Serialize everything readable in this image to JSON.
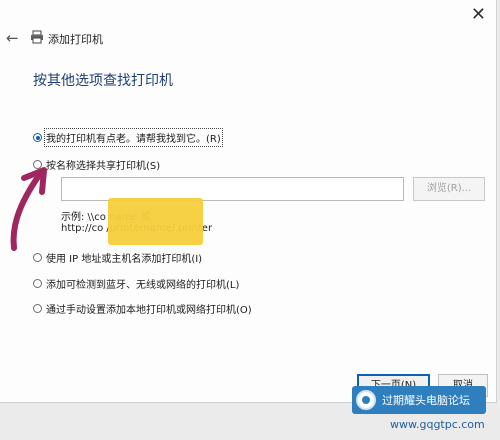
{
  "window": {
    "close_glyph": "✕",
    "back_glyph": "←",
    "title": "添加打印机"
  },
  "heading": "按其他选项查找打印机",
  "options": [
    {
      "label": "我的打印机有点老。请帮我找到它。(R)",
      "checked": true
    },
    {
      "label": "按名称选择共享打印机(S)",
      "checked": false
    },
    {
      "label": "使用 IP 地址或主机名添加打印机(I)",
      "checked": false
    },
    {
      "label": "添加可检测到蓝牙、无线或网络的打印机(L)",
      "checked": false
    },
    {
      "label": "通过手动设置添加本地打印机或网络打印机(O)",
      "checked": false
    }
  ],
  "share_input": {
    "value": ""
  },
  "browse_label": "浏览(R)...",
  "example_line1": "示例: \\\\co                            name 或",
  "example_line2": "http://co                            /printername/.printer",
  "buttons": {
    "next": "下一页(N)",
    "cancel": "取消"
  },
  "watermark": {
    "text": "过期耀头电脑论坛",
    "site": "www.gqgtpc.com"
  },
  "colors": {
    "accent": "#0b61b3",
    "heading": "#1f3f77",
    "annotation_arrow": "#a0265f"
  }
}
